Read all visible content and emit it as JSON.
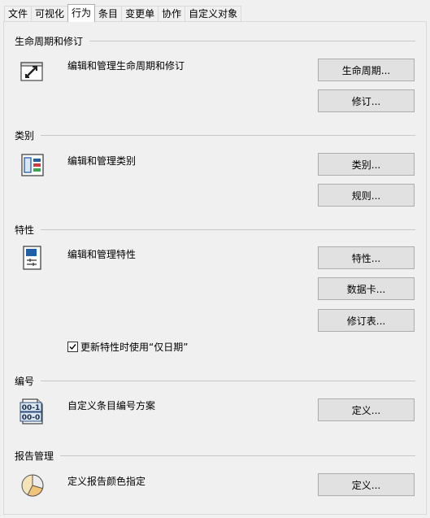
{
  "tabs": [
    "文件",
    "可视化",
    "行为",
    "条目",
    "变更单",
    "协作",
    "自定义对象"
  ],
  "active_tab_index": 2,
  "sections": {
    "lifecycle": {
      "title": "生命周期和修订",
      "description": "编辑和管理生命周期和修订",
      "buttons": [
        "生命周期...",
        "修订..."
      ],
      "icon": "edit-window-icon"
    },
    "category": {
      "title": "类别",
      "description": "编辑和管理类别",
      "buttons": [
        "类别...",
        "规则..."
      ],
      "icon": "category-list-icon"
    },
    "property": {
      "title": "特性",
      "description": "编辑和管理特性",
      "buttons": [
        "特性...",
        "数据卡...",
        "修订表..."
      ],
      "icon": "property-sheet-icon",
      "checkbox": {
        "label": "更新特性时使用“仅日期”",
        "checked": true
      }
    },
    "numbering": {
      "title": "编号",
      "description": "自定义条目编号方案",
      "buttons": [
        "定义..."
      ],
      "icon": "numbering-scheme-icon",
      "icon_text": [
        "00-1",
        "00-0"
      ]
    },
    "report": {
      "title": "报告管理",
      "description": "定义报告颜色指定",
      "buttons": [
        "定义..."
      ],
      "icon": "pie-chart-icon"
    }
  }
}
